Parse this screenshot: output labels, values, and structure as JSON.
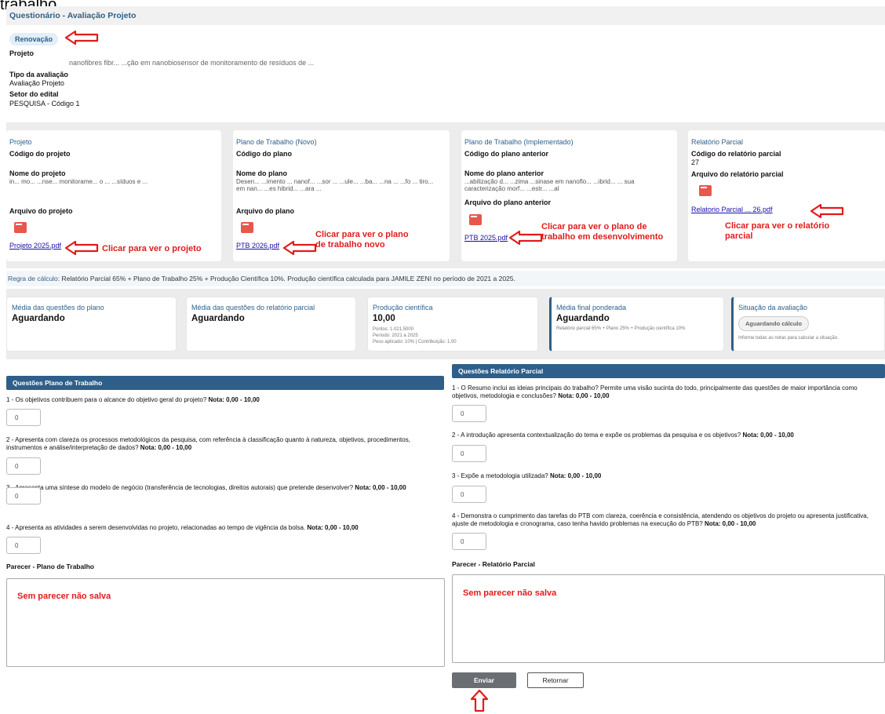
{
  "top_clip": "trabalho.",
  "header": {
    "title": "Questionário - Avaliação Projeto"
  },
  "info": {
    "badge": "Renovação",
    "projeto_label": "Projeto",
    "projeto_value": "nanofibres fibr... ...ção em nanobiosensor de monitoramento de resíduos de ...",
    "tipo_label": "Tipo da avaliação",
    "tipo_value": "Avaliação Projeto",
    "setor_label": "Setor do edital",
    "setor_value": "PESQUISA - Código 1"
  },
  "cards": [
    {
      "title": "Projeto",
      "code_label": "Código do projeto",
      "code_value": "",
      "name_label": "Nome do projeto",
      "name_value": "in... mo... ...nse... monitorame... o ... ...síduos e ...",
      "file_label": "Arquivo do projeto",
      "file_name": "Projeto 2025.pdf"
    },
    {
      "title": "Plano de Trabalho (Novo)",
      "code_label": "Código do plano",
      "code_value": "",
      "name_label": "Nome do plano",
      "name_value": "Desen... ...imento ... nanof... ...sor ... ...ule... ...ba... ...na ... ...fo ... tiro... em nan... ...es hibrid... ...ara ...",
      "file_label": "Arquivo do plano",
      "file_name": "PTB 2026.pdf"
    },
    {
      "title": "Plano de Trabalho (Implementado)",
      "code_label": "Código do plano anterior",
      "code_value": "",
      "name_label": "Nome do plano anterior",
      "name_value": "...abilização d... ...zima ...sinase em nanoflo... ...ibrid... ... sua caracterização morf... ...estr... ...al",
      "file_label": "Arquivo do plano anterior",
      "file_name": "PTB 2025.pdf"
    },
    {
      "title": "Relatório Parcial",
      "code_label": "Código do relatório parcial",
      "code_value": "27",
      "file_label": "Arquivo do relatório parcial",
      "file_name": "Relatorio Parcial ... 26.pdf"
    }
  ],
  "rule": {
    "label": "Regra de cálculo:",
    "text": " Relatório Parcial 65% + Plano de Trabalho 25% + Produção Científica 10%. Produção científica calculada para JAMILE ZENI no período de 2021 a 2025."
  },
  "stats": {
    "plano": {
      "title": "Média das questões do plano",
      "value": "Aguardando"
    },
    "relatorio": {
      "title": "Média das questões do relatório parcial",
      "value": "Aguardando"
    },
    "producao": {
      "title": "Produção científica",
      "value": "10,00",
      "pontos": "Pontos: 1.021,5000",
      "periodo": "Período: 2021 a 2025",
      "peso": "Peso aplicado: 10% | Contribuição: 1,00"
    },
    "media_final": {
      "title": "Média final ponderada",
      "value": "Aguardando",
      "note": "Relatório parcial 65% + Plano 25% + Produção científica 10%"
    },
    "situacao": {
      "title": "Situação da avaliação",
      "pill": "Aguardando cálculo",
      "note": "Informe todas as notas para calcular a situação."
    }
  },
  "plano_section": {
    "title": "Questões Plano de Trabalho",
    "questions": [
      {
        "text": "1 - Os objetivos contribuem para o alcance do objetivo geral do projeto?",
        "nota": "Nota: 0,00 - 10,00",
        "value": "0"
      },
      {
        "text": "2 - Apresenta com clareza os processos metodológicos da pesquisa, com referência à classificação quanto à natureza, objetivos, procedimentos, instrumentos e análise/interpretação de dados?",
        "nota": "Nota: 0,00 - 10,00",
        "value": "0"
      },
      {
        "text": "3 - Apresenta uma síntese do modelo de negócio (transferência de tecnologias, direitos autorais) que pretende desenvolver?",
        "nota": "Nota: 0,00 - 10,00",
        "value": "0"
      },
      {
        "text": "4 - Apresenta as atividades a serem desenvolvidas no projeto, relacionadas ao tempo de vigência da bolsa.",
        "nota": "Nota: 0,00 - 10,00",
        "value": "0"
      }
    ],
    "parecer_label": "Parecer - Plano de Trabalho"
  },
  "relatorio_section": {
    "title": "Questões Relatório Parcial",
    "questions": [
      {
        "text": "1 - O Resumo inclui as ideias principais do trabalho? Permite uma visão sucinta do todo, principalmente das questões de maior importância como objetivos, metodologia e conclusões?",
        "nota": "Nota: 0,00 - 10,00",
        "value": "0"
      },
      {
        "text": "2 - A introdução apresenta contextualização do tema e expõe os problemas da pesquisa e os objetivos?",
        "nota": "Nota: 0,00 - 10,00",
        "value": "0"
      },
      {
        "text": "3 - Expõe a metodologia utilizada?",
        "nota": "Nota: 0,00 - 10,00",
        "value": "0"
      },
      {
        "text": "4 - Demonstra o cumprimento das tarefas do PTB com clareza, coerência e consistência, atendendo os objetivos do projeto ou apresenta justificativa, ajuste de metodologia e cronograma, caso tenha havido problemas na execução do PTB?",
        "nota": "Nota: 0,00 - 10,00",
        "value": "0"
      }
    ],
    "parecer_label": "Parecer - Relatório Parcial"
  },
  "buttons": {
    "enviar": "Enviar",
    "retornar": "Retornar"
  },
  "annotations": {
    "projeto": "Clicar para ver o projeto",
    "plano_novo": "Clicar para ver o plano de trabalho novo",
    "plano_impl": "Clicar para ver o plano de trabalho em desenvolvimento",
    "relatorio": "Clicar para ver o relatório parcial",
    "parecer_plano": "Sem parecer não salva",
    "parecer_relatorio": "Sem parecer não salva"
  },
  "colors": {
    "accent": "#2e5f8a",
    "annotation": "#e21b1b",
    "band": "#ececec"
  }
}
